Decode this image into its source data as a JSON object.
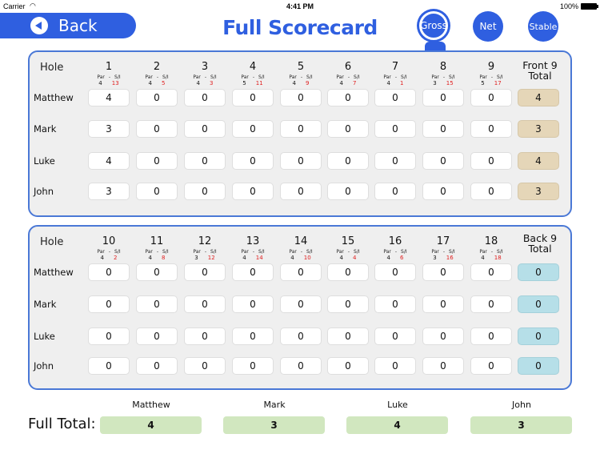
{
  "status_bar": {
    "carrier": "Carrier",
    "time": "4:41 PM",
    "battery": "100%"
  },
  "header": {
    "back_label": "Back",
    "title": "Full Scorecard",
    "modes": [
      {
        "label": "Gross",
        "selected": true
      },
      {
        "label": "Net",
        "selected": false
      },
      {
        "label": "Stable",
        "selected": false
      }
    ]
  },
  "labels": {
    "hole": "Hole",
    "par": "Par",
    "dash": "-",
    "si": "S/I",
    "front_total": [
      "Front 9",
      "Total"
    ],
    "back_total": [
      "Back 9",
      "Total"
    ],
    "full_total": "Full Total:"
  },
  "players": [
    "Matthew",
    "Mark",
    "Luke",
    "John"
  ],
  "front_nine": {
    "holes": [
      {
        "hole": "1",
        "par": "4",
        "si": "13"
      },
      {
        "hole": "2",
        "par": "4",
        "si": "5"
      },
      {
        "hole": "3",
        "par": "4",
        "si": "3"
      },
      {
        "hole": "4",
        "par": "5",
        "si": "11"
      },
      {
        "hole": "5",
        "par": "4",
        "si": "9"
      },
      {
        "hole": "6",
        "par": "4",
        "si": "7"
      },
      {
        "hole": "7",
        "par": "4",
        "si": "1"
      },
      {
        "hole": "8",
        "par": "3",
        "si": "15"
      },
      {
        "hole": "9",
        "par": "5",
        "si": "17"
      }
    ],
    "scores": [
      [
        "4",
        "0",
        "0",
        "0",
        "0",
        "0",
        "0",
        "0",
        "0"
      ],
      [
        "3",
        "0",
        "0",
        "0",
        "0",
        "0",
        "0",
        "0",
        "0"
      ],
      [
        "4",
        "0",
        "0",
        "0",
        "0",
        "0",
        "0",
        "0",
        "0"
      ],
      [
        "3",
        "0",
        "0",
        "0",
        "0",
        "0",
        "0",
        "0",
        "0"
      ]
    ],
    "totals": [
      "4",
      "3",
      "4",
      "3"
    ]
  },
  "back_nine": {
    "holes": [
      {
        "hole": "10",
        "par": "4",
        "si": "2"
      },
      {
        "hole": "11",
        "par": "4",
        "si": "8"
      },
      {
        "hole": "12",
        "par": "3",
        "si": "12"
      },
      {
        "hole": "13",
        "par": "4",
        "si": "14"
      },
      {
        "hole": "14",
        "par": "4",
        "si": "10"
      },
      {
        "hole": "15",
        "par": "4",
        "si": "4"
      },
      {
        "hole": "16",
        "par": "4",
        "si": "6"
      },
      {
        "hole": "17",
        "par": "3",
        "si": "16"
      },
      {
        "hole": "18",
        "par": "4",
        "si": "18"
      }
    ],
    "scores": [
      [
        "0",
        "0",
        "0",
        "0",
        "0",
        "0",
        "0",
        "0",
        "0"
      ],
      [
        "0",
        "0",
        "0",
        "0",
        "0",
        "0",
        "0",
        "0",
        "0"
      ],
      [
        "0",
        "0",
        "0",
        "0",
        "0",
        "0",
        "0",
        "0",
        "0"
      ],
      [
        "0",
        "0",
        "0",
        "0",
        "0",
        "0",
        "0",
        "0",
        "0"
      ]
    ],
    "totals": [
      "0",
      "0",
      "0",
      "0"
    ]
  },
  "full_totals": [
    {
      "player": "Matthew",
      "total": "4"
    },
    {
      "player": "Mark",
      "total": "3"
    },
    {
      "player": "Luke",
      "total": "4"
    },
    {
      "player": "John",
      "total": "3"
    }
  ]
}
